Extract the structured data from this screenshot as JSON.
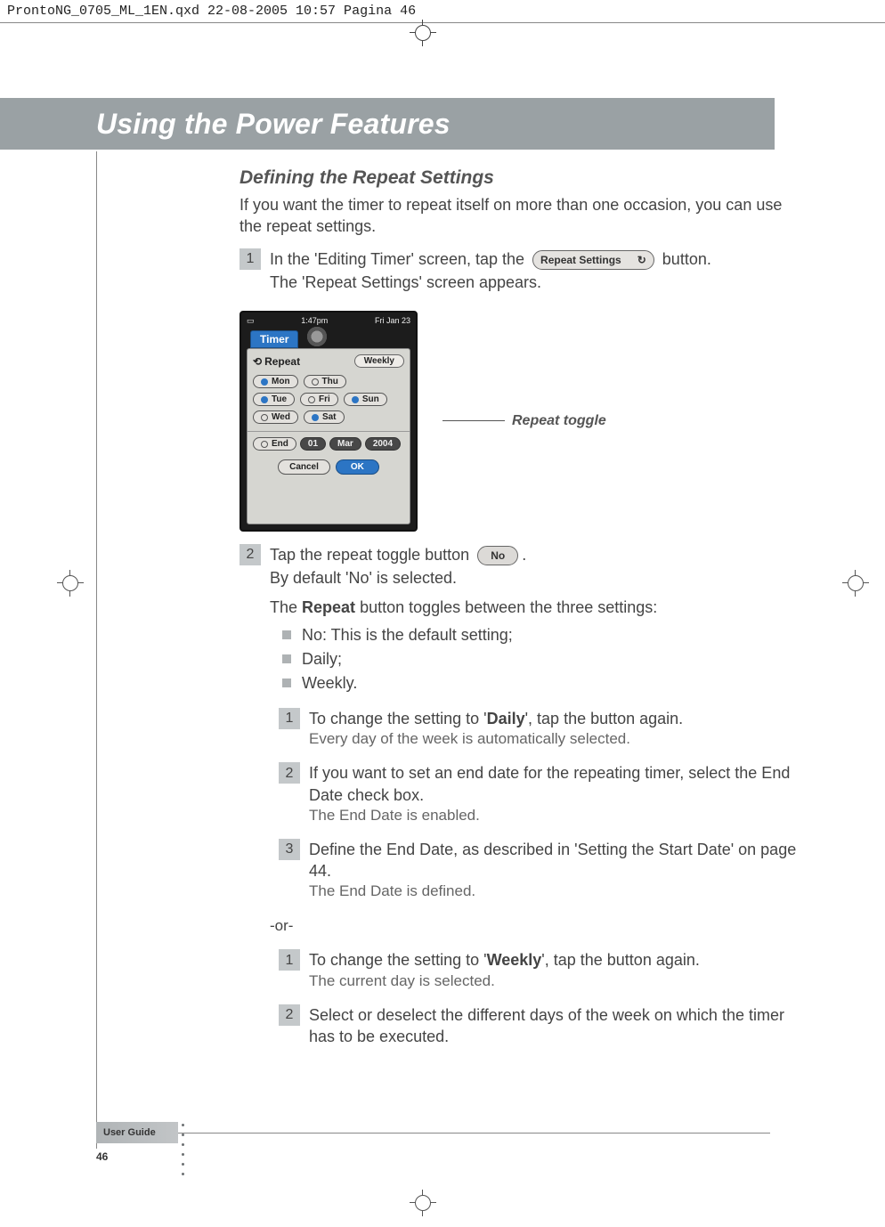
{
  "header_filename": "ProntoNG_0705_ML_1EN.qxd   22-08-2005   10:57   Pagina 46",
  "banner_title": "Using the Power Features",
  "section": {
    "title": "Defining the Repeat Settings",
    "intro": "If you want the timer to repeat itself on more than one occasion, you can use the repeat settings.",
    "step1_num": "1",
    "step1_pre": "In the 'Editing Timer' screen, tap the ",
    "step1_pill_label": "Repeat Settings",
    "step1_post": "button.",
    "step1_sub": "The 'Repeat Settings' screen appears.",
    "screenshot": {
      "status_time": "1:47pm",
      "status_date": "Fri Jan 23",
      "tab": "Timer",
      "repeat_label": "Repeat",
      "repeat_value": "Weekly",
      "days": {
        "mon": "Mon",
        "thu": "Thu",
        "tue": "Tue",
        "fri": "Fri",
        "sun": "Sun",
        "wed": "Wed",
        "sat": "Sat"
      },
      "end_label": "End",
      "end_day": "01",
      "end_month": "Mar",
      "end_year": "2004",
      "cancel": "Cancel",
      "ok": "OK"
    },
    "repeat_callout": "Repeat toggle",
    "step2_num": "2",
    "step2_pre": "Tap the repeat toggle button ",
    "step2_pill_label": "No",
    "step2_post": ".",
    "step2_sub": "By default 'No' is selected.",
    "repeat_desc_pre": "The ",
    "repeat_desc_bold": "Repeat",
    "repeat_desc_post": " button toggles between the three settings:",
    "bullets": {
      "b1": "No: This is the default setting;",
      "b2": "Daily;",
      "b3": "Weekly."
    },
    "inner_daily": {
      "s1_num": "1",
      "s1_pre": "To change the setting to '",
      "s1_bold": "Daily",
      "s1_post": "', tap the button again.",
      "s1_sub": "Every day of the week is automatically selected.",
      "s2_num": "2",
      "s2_main": "If you want to set an end date for the repeating timer, select the End Date check box.",
      "s2_sub": "The End Date is enabled.",
      "s3_num": "3",
      "s3_main": "Define the End Date, as described in 'Setting the Start Date' on page 44.",
      "s3_sub": "The End Date is defined."
    },
    "or": "-or-",
    "inner_weekly": {
      "s1_num": "1",
      "s1_pre": "To change the setting to '",
      "s1_bold": "Weekly",
      "s1_post": "', tap the button again.",
      "s1_sub": "The current day is selected.",
      "s2_num": "2",
      "s2_main": "Select or deselect the different days of the week on which the timer has to be executed."
    }
  },
  "footer": {
    "tab": "User Guide",
    "page": "46"
  }
}
